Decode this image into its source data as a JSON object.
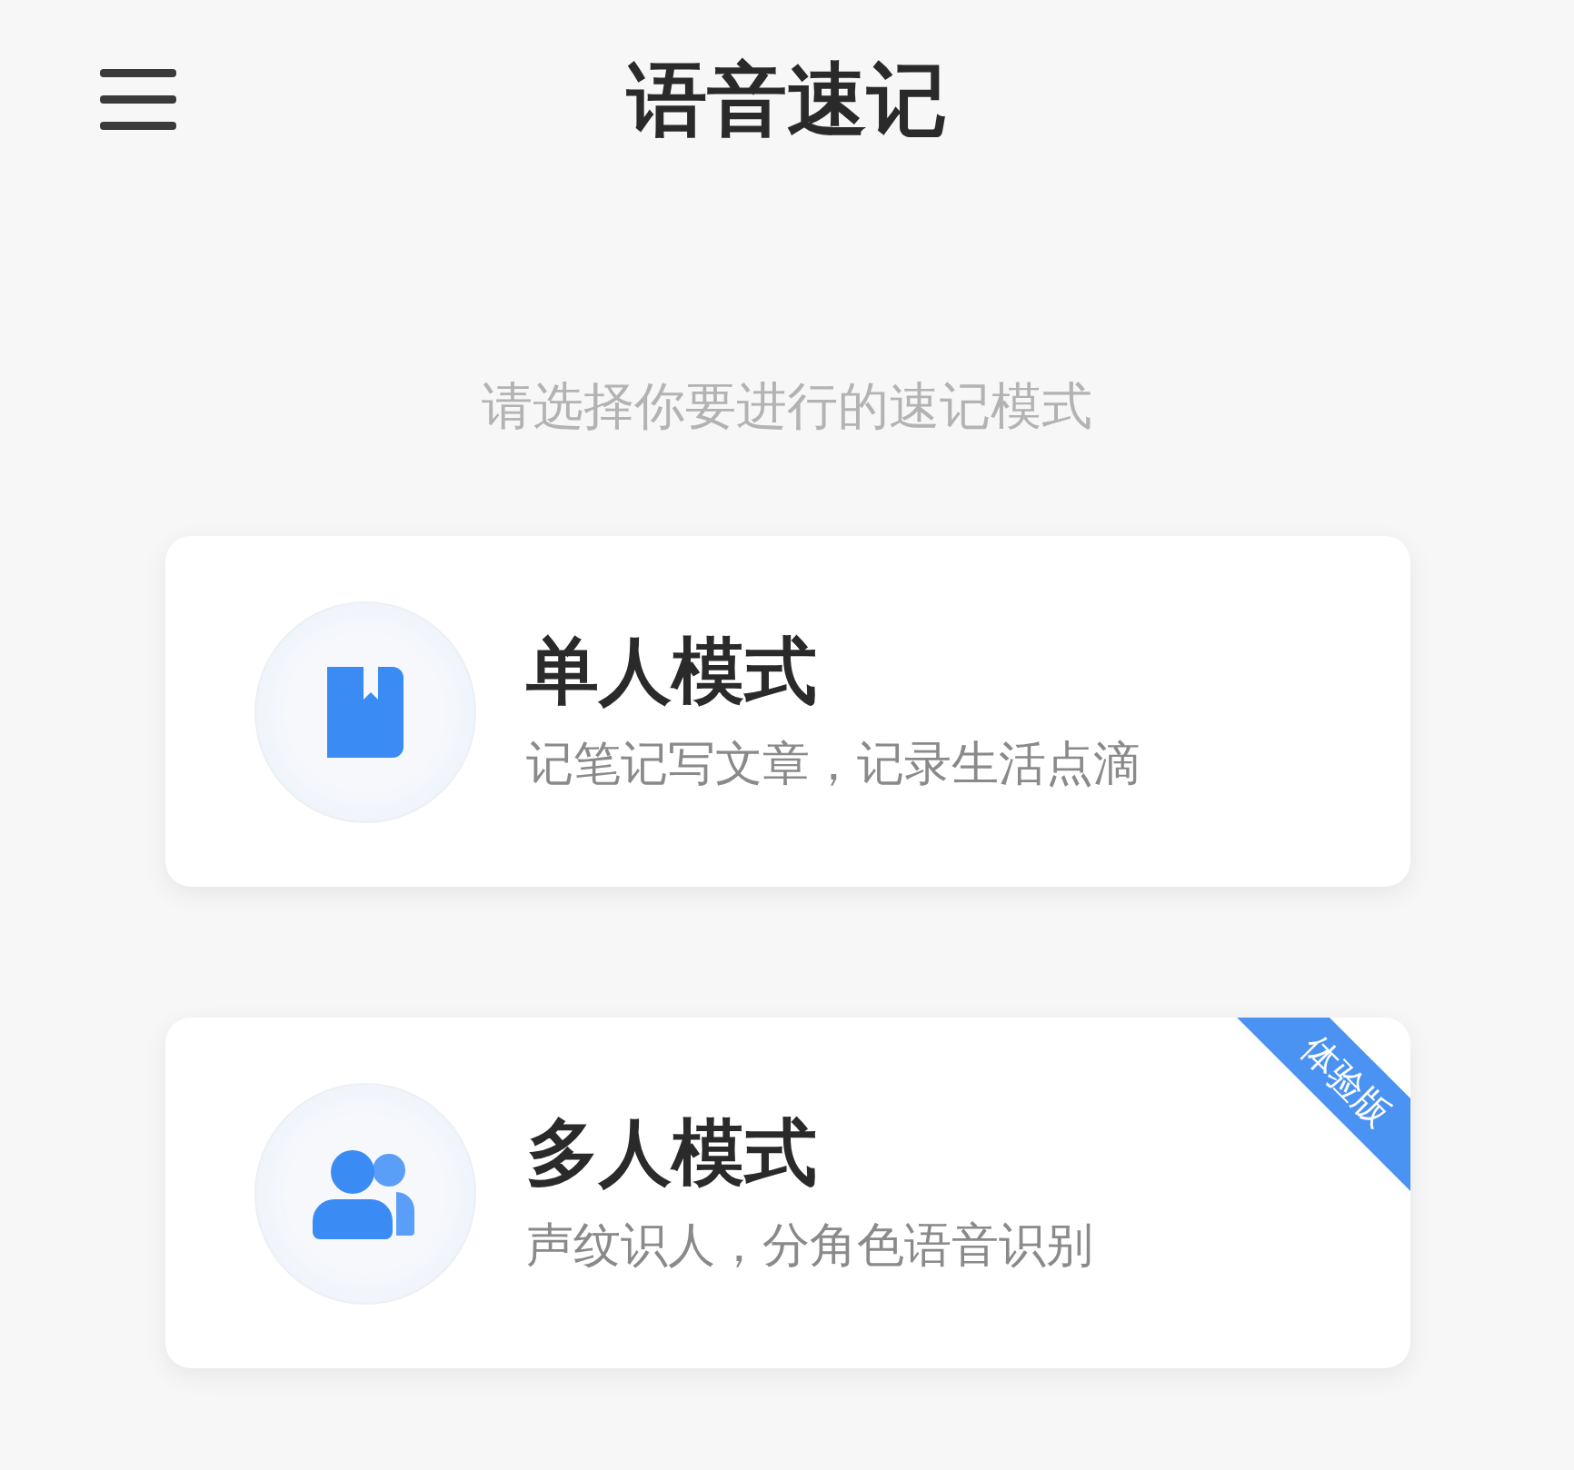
{
  "header": {
    "title": "语音速记"
  },
  "prompt": "请选择你要进行的速记模式",
  "modes": [
    {
      "kind": "book",
      "title": "单人模式",
      "subtitle": "记笔记写文章，记录生活点滴"
    },
    {
      "kind": "people",
      "title": "多人模式",
      "subtitle": "声纹识人，分角色语音识别",
      "ribbon": "体验版"
    }
  ]
}
